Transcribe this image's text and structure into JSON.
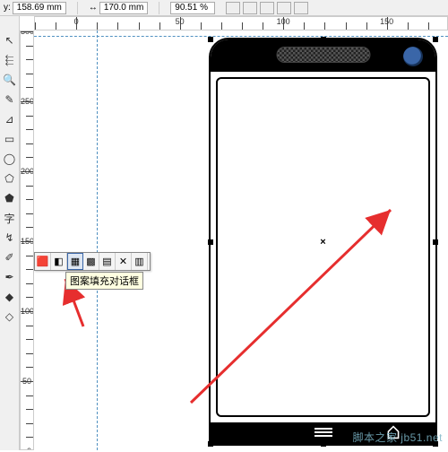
{
  "status": {
    "y_label": "y:",
    "y_value": "158.69 mm",
    "w_label": "↔",
    "w_value": "170.0 mm",
    "zoom": "90.51 %"
  },
  "ruler_h": {
    "start": -20,
    "end": 180,
    "major_every": 50,
    "step": 10
  },
  "ruler_v": {
    "start": 300,
    "end": 0,
    "major_every": 50,
    "step": 10
  },
  "guides": {
    "v_mm": 0,
    "h_mm": 300
  },
  "object_center": "×",
  "tooltip": "图案填充对话框",
  "fill_buttons": [
    {
      "name": "uniform-fill",
      "glyph": "🟥"
    },
    {
      "name": "fountain-fill",
      "glyph": "◧"
    },
    {
      "name": "pattern-fill",
      "glyph": "▦",
      "active": true
    },
    {
      "name": "texture-fill",
      "glyph": "▩"
    },
    {
      "name": "postscript-fill",
      "glyph": "▤"
    },
    {
      "name": "no-fill",
      "glyph": "✕"
    },
    {
      "name": "color-docker",
      "glyph": "▥"
    }
  ],
  "tools": [
    {
      "name": "pick-tool",
      "glyph": "↖"
    },
    {
      "name": "shape-tool",
      "glyph": "⬱"
    },
    {
      "name": "zoom-tool",
      "glyph": "🔍"
    },
    {
      "name": "freehand-tool",
      "glyph": "✎"
    },
    {
      "name": "smart-drawing-tool",
      "glyph": "⊿"
    },
    {
      "name": "rectangle-tool",
      "glyph": "▭"
    },
    {
      "name": "ellipse-tool",
      "glyph": "◯"
    },
    {
      "name": "polygon-tool",
      "glyph": "⬠"
    },
    {
      "name": "basic-shapes-tool",
      "glyph": "⬟"
    },
    {
      "name": "text-tool",
      "glyph": "字"
    },
    {
      "name": "interactive-blend-tool",
      "glyph": "↯"
    },
    {
      "name": "eyedropper-tool",
      "glyph": "✐"
    },
    {
      "name": "outline-tool",
      "glyph": "✒"
    },
    {
      "name": "fill-tool",
      "glyph": "◆"
    },
    {
      "name": "interactive-fill-tool",
      "glyph": "◇"
    }
  ],
  "phone": {
    "speaker_name": "speaker-grille",
    "camera_name": "front-camera"
  },
  "watermark": "脚本之家 jb51.net"
}
